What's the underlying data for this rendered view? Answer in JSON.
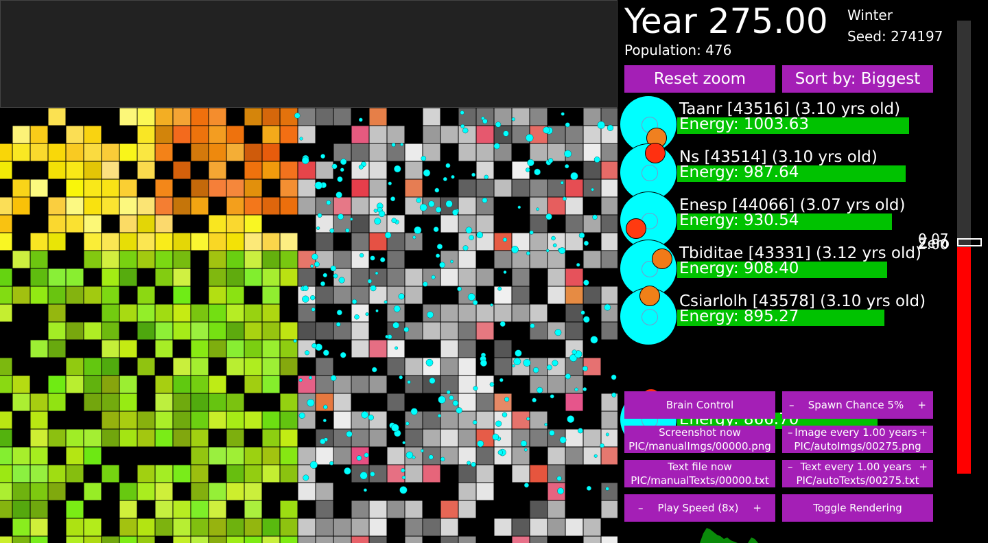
{
  "header": {
    "year": "Year 275.00",
    "season": "Winter",
    "seed": "Seed: 274197",
    "population": "Population: 476"
  },
  "top_buttons": {
    "reset_zoom": "Reset zoom",
    "sort_by": "Sort by: Biggest"
  },
  "creatures": [
    {
      "name": "Taanr [43516] (3.10 yrs old)",
      "energy": "Energy: 1003.63",
      "energy_value": 1003.63,
      "mouth_color": "#f08020"
    },
    {
      "name": "Ns [43514] (3.10 yrs old)",
      "energy": "Energy: 987.64",
      "energy_value": 987.64,
      "mouth_color": "#ff3010"
    },
    {
      "name": "Enesp [44066] (3.07 yrs old)",
      "energy": "Energy: 930.54",
      "energy_value": 930.54,
      "mouth_color": "#ff3a10"
    },
    {
      "name": "Tbiditae [43331] (3.12 yrs old)",
      "energy": "Energy: 908.40",
      "energy_value": 908.4,
      "mouth_color": "#f07a18"
    },
    {
      "name": "Csiarlolh [43578] (3.10 yrs old)",
      "energy": "Energy: 895.27",
      "energy_value": 895.27,
      "mouth_color": "#f08018"
    },
    {
      "name": "",
      "energy": "Energy: 866.70",
      "energy_value": 866.7,
      "mouth_color": "#ff3010"
    }
  ],
  "controls": {
    "brain_control": "Brain Control",
    "spawn_minus": "–",
    "spawn_label": "Spawn Chance 5%",
    "spawn_plus": "+",
    "screenshot_title": "Screenshot now",
    "screenshot_path": "PIC/manualImgs/00000.png",
    "image_minus": "–",
    "image_label": "Image every 1.00 years",
    "image_plus": "+",
    "image_path": "PIC/autoImgs/00275.png",
    "textfile_title": "Text file now",
    "textfile_path": "PIC/manualTexts/00000.txt",
    "text_minus": "–",
    "text_label": "Text every 1.00 years",
    "text_plus": "+",
    "text_path": "PIC/autoTexts/00275.txt",
    "speed_minus": "–",
    "speed_label": "Play Speed (8x)",
    "speed_plus": "+",
    "toggle_rendering": "Toggle Rendering"
  },
  "scale": {
    "label_a": "0.07",
    "label_b": "Zero",
    "label_c": "2.00",
    "fill_fraction": 0.5
  },
  "colors": {
    "button": "#a41fb6",
    "creature_body": "#00ffff",
    "energy_bar": "#00c200",
    "scale_fill": "#ff0000"
  }
}
